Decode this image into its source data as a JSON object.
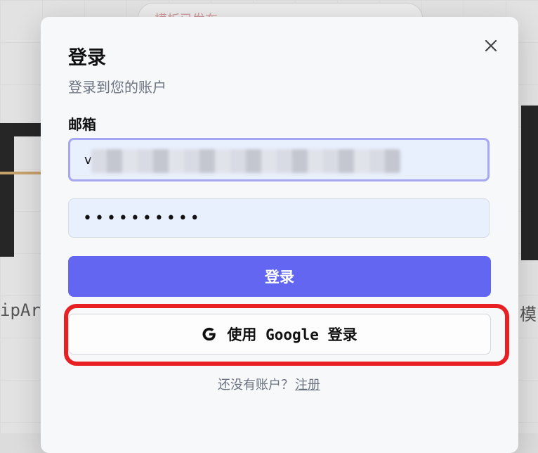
{
  "background": {
    "pill_text": "模板已发布",
    "left_side_text": "ipAr",
    "right_side_text": "模"
  },
  "modal": {
    "title": "登录",
    "subtitle": "登录到您的账户",
    "email_label": "邮箱",
    "email_value": "v",
    "password_value": "••••••••••",
    "login_button": "登录",
    "google_button": "使用 Google 登录",
    "no_account_text": "还没有账户？",
    "signup_link": "注册"
  },
  "icons": {
    "close": "close-icon",
    "google": "google-icon"
  },
  "colors": {
    "primary": "#6366f1",
    "highlight": "#e81f23",
    "input_bg": "#e8effd",
    "focus_ring": "#a5a8f0"
  }
}
